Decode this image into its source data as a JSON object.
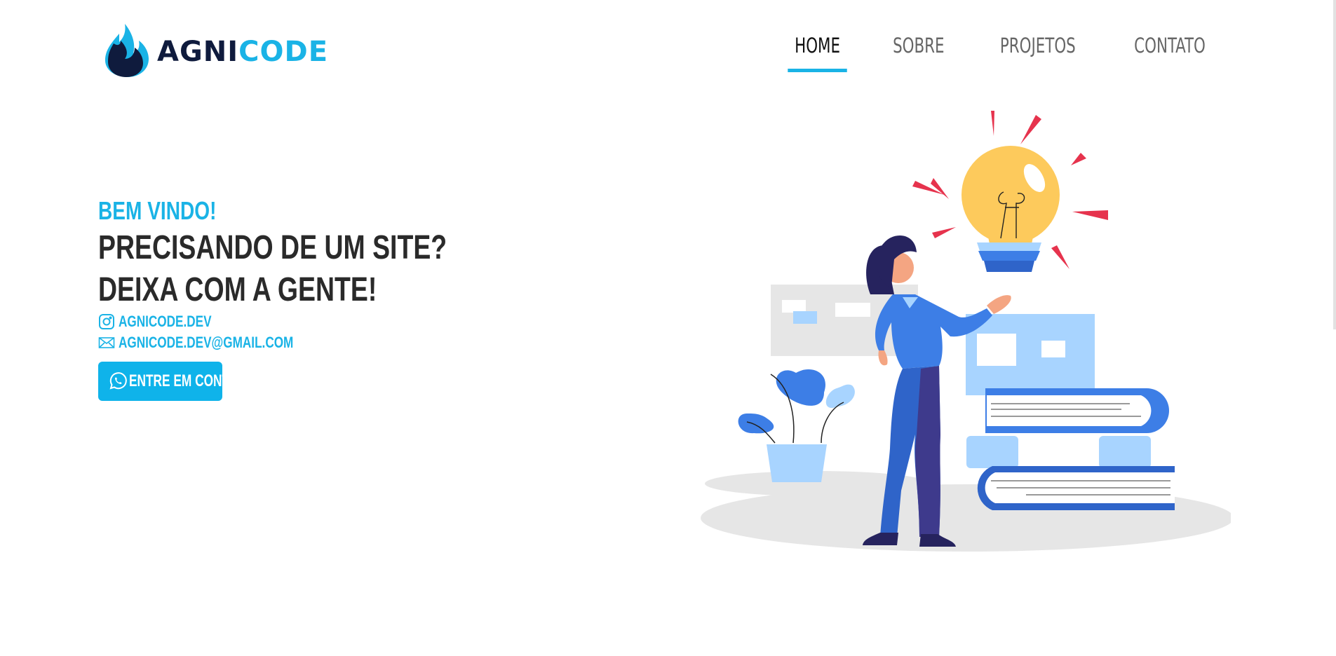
{
  "brand": {
    "part1": "AGNI",
    "part2": "CODE"
  },
  "nav": [
    {
      "label": "HOME",
      "active": true
    },
    {
      "label": "SOBRE",
      "active": false
    },
    {
      "label": "PROJETOS",
      "active": false
    },
    {
      "label": "CONTATO",
      "active": false
    }
  ],
  "hero": {
    "welcome": "BEM VINDO!",
    "headline_line1": "PRECISANDO DE UM SITE?",
    "headline_line2": "DEIXA COM A GENTE!",
    "instagram": "AGNICODE.DEV",
    "email": "AGNICODE.DEV@GMAIL.COM",
    "cta_label": "ENTRE EM CONTATO"
  },
  "colors": {
    "accent": "#1ab3e6",
    "dark": "#0f1b3d",
    "button": "#0fb3ea"
  },
  "icons": {
    "logo": "flame-icon",
    "instagram": "instagram-icon",
    "email": "envelope-icon",
    "whatsapp": "whatsapp-icon"
  }
}
